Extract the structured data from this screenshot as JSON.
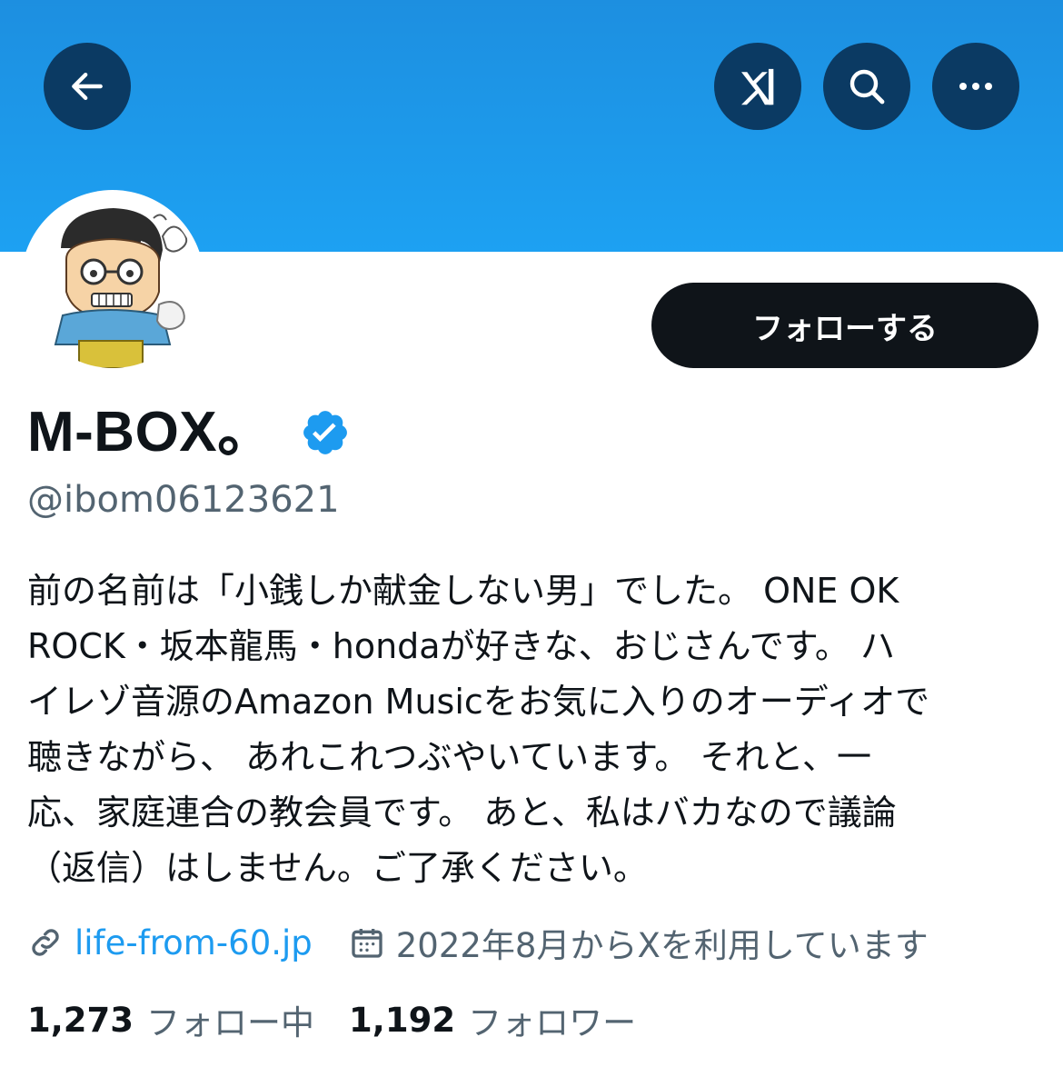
{
  "header": {
    "banner_color": "#1da1f2",
    "buttons": [
      {
        "name": "back",
        "icon": "arrow-left-icon"
      },
      {
        "name": "grok",
        "icon": "grok-icon"
      },
      {
        "name": "search",
        "icon": "search-icon"
      },
      {
        "name": "more",
        "icon": "more-dots-icon"
      }
    ]
  },
  "profile": {
    "display_name": "M-BOX。",
    "verified": true,
    "handle": "@ibom06123621",
    "follow_label": "フォローする",
    "bio_lines": [
      "前の名前は「小銭しか献金しない男」でした。 ONE OK",
      "ROCK・坂本龍馬・hondaが好きな、おじさんです。 ハ",
      "イレゾ音源のAmazon Musicをお気に入りのオーディオで",
      "聴きながら、 あれこれつぶやいています。 それと、一",
      "応、家庭連合の教会員です。 あと、私はバカなので議論",
      "（返信）はしません。ご了承ください。"
    ],
    "website": "life-from-60.jp",
    "joined": "2022年8月からXを利用しています",
    "following_count": "1,273",
    "following_label": "フォロー中",
    "followers_count": "1,192",
    "followers_label": "フォロワー"
  },
  "colors": {
    "accent": "#1d9bf0",
    "dark_button": "#0f1419",
    "secondary_text": "#536471"
  }
}
